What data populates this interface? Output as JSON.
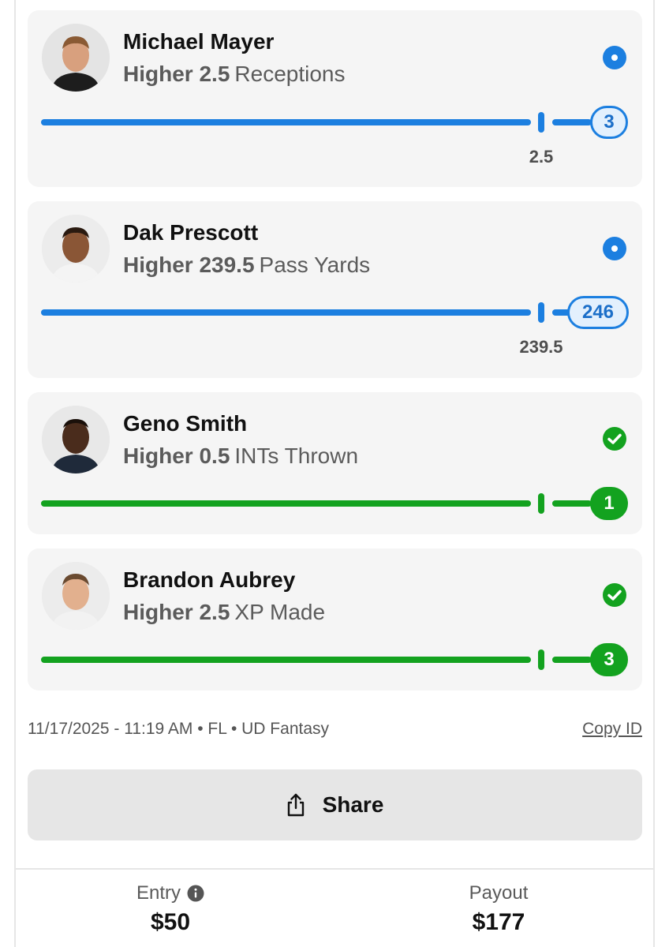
{
  "picks": [
    {
      "player": "Michael Mayer",
      "direction": "Higher",
      "line": "2.5",
      "stat": "Receptions",
      "result": "3",
      "tick_label": "2.5",
      "status": "in-progress",
      "status_icon": "live-dot-icon",
      "accent_color": "#1c7fe0"
    },
    {
      "player": "Dak Prescott",
      "direction": "Higher",
      "line": "239.5",
      "stat": "Pass Yards",
      "result": "246",
      "tick_label": "239.5",
      "status": "in-progress",
      "status_icon": "live-dot-icon",
      "accent_color": "#1c7fe0"
    },
    {
      "player": "Geno Smith",
      "direction": "Higher",
      "line": "0.5",
      "stat": "INTs Thrown",
      "result": "1",
      "status": "won",
      "status_icon": "check-circle-icon",
      "accent_color": "#13a21f"
    },
    {
      "player": "Brandon Aubrey",
      "direction": "Higher",
      "line": "2.5",
      "stat": "XP Made",
      "result": "3",
      "status": "won",
      "status_icon": "check-circle-icon",
      "accent_color": "#13a21f"
    }
  ],
  "meta": {
    "timestamp": "11/17/2025 - 11:19 AM • FL • UD Fantasy",
    "copy_id_label": "Copy ID"
  },
  "share": {
    "label": "Share",
    "icon": "share-icon"
  },
  "summary": {
    "entry_label": "Entry",
    "entry_value": "$50",
    "payout_label": "Payout",
    "payout_value": "$177"
  }
}
